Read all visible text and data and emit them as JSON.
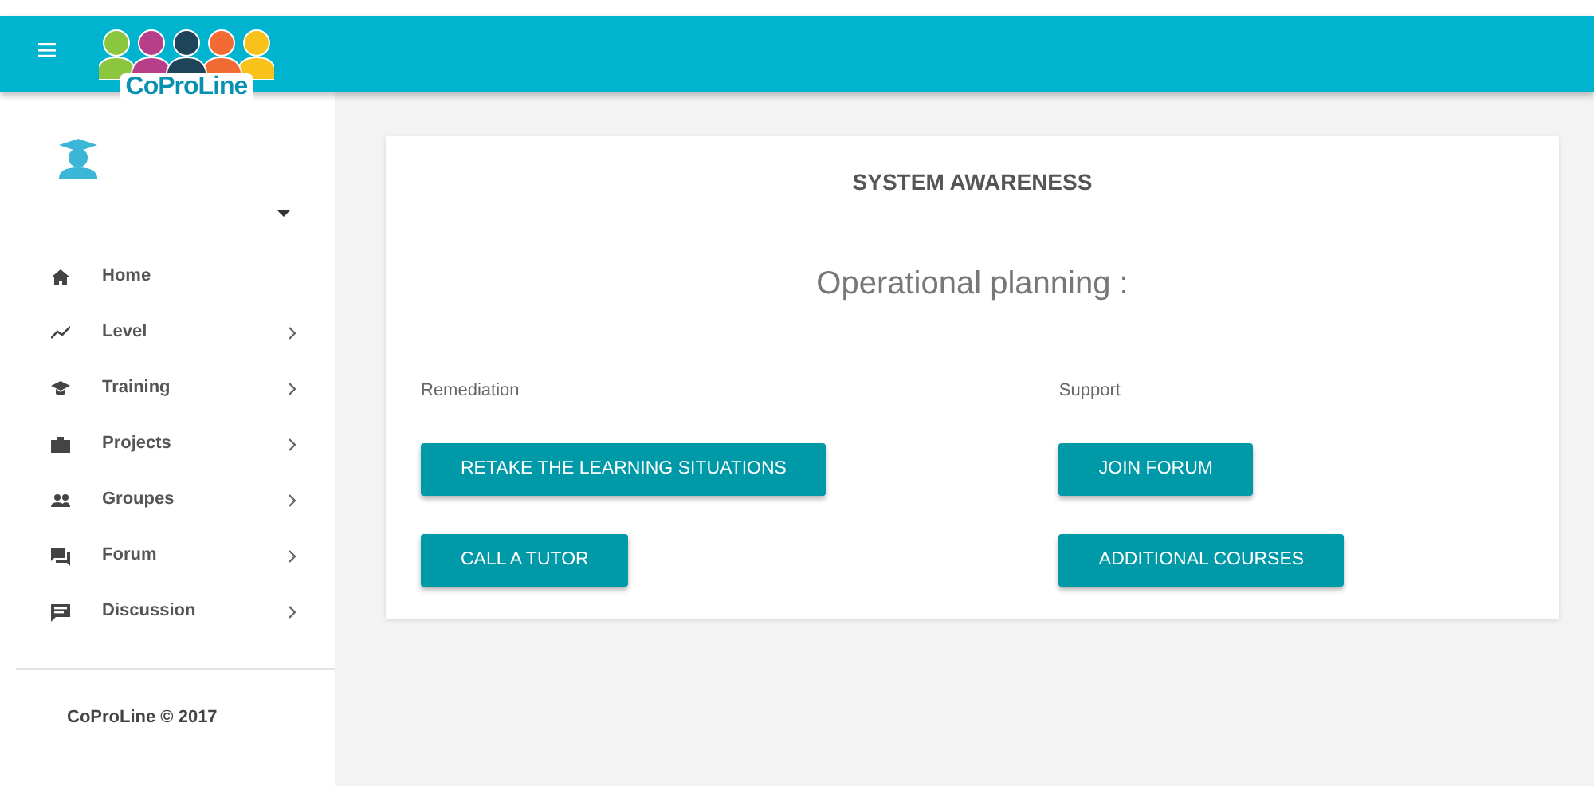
{
  "header": {
    "logo_text": "CoProLine"
  },
  "sidebar": {
    "items": [
      {
        "label": "Home",
        "expandable": false
      },
      {
        "label": "Level",
        "expandable": true
      },
      {
        "label": "Training",
        "expandable": true
      },
      {
        "label": "Projects",
        "expandable": true
      },
      {
        "label": "Groupes",
        "expandable": true
      },
      {
        "label": "Forum",
        "expandable": true
      },
      {
        "label": "Discussion",
        "expandable": true
      }
    ],
    "footer": "CoProLine © 2017"
  },
  "card": {
    "title": "SYSTEM AWARENESS",
    "subtitle": "Operational planning :",
    "columns": [
      {
        "heading": "Remediation",
        "buttons": [
          "RETAKE THE LEARNING SITUATIONS",
          "CALL A TUTOR"
        ]
      },
      {
        "heading": "Support",
        "buttons": [
          "JOIN FORUM",
          "ADDITIONAL COURSES"
        ]
      }
    ]
  }
}
